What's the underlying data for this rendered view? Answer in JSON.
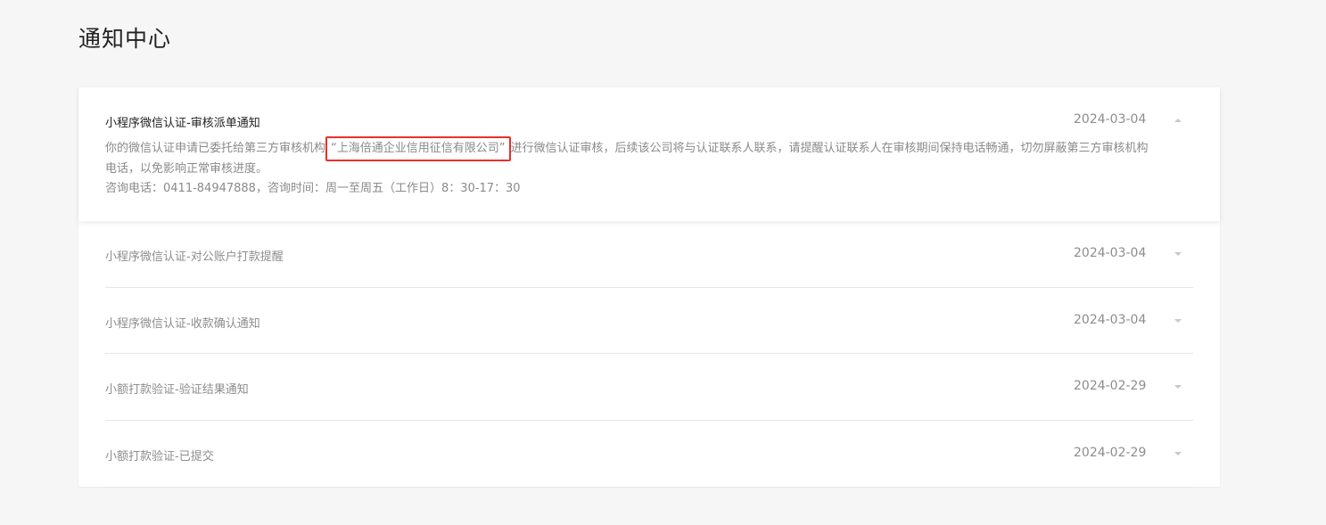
{
  "page": {
    "title": "通知中心"
  },
  "notifications": [
    {
      "title": "小程序微信认证-审核派单通知",
      "date": "2024-03-04",
      "expanded": true,
      "body_before": "你的微信认证申请已委托给第三方审核机构",
      "body_highlight": "“上海倍通企业信用征信有限公司”",
      "body_after": "进行微信认证审核，后续该公司将与认证联系人联系，请提醒认证联系人在审核期间保持电话畅通，切勿屏蔽第三方审核机构电话，以免影响正常审核进度。",
      "body_contact": "咨询电话：0411-84947888，咨询时间：周一至周五（工作日）8：30-17：30"
    },
    {
      "title": "小程序微信认证-对公账户打款提醒",
      "date": "2024-03-04",
      "expanded": false
    },
    {
      "title": "小程序微信认证-收款确认通知",
      "date": "2024-03-04",
      "expanded": false
    },
    {
      "title": "小额打款验证-验证结果通知",
      "date": "2024-02-29",
      "expanded": false
    },
    {
      "title": "小额打款验证-已提交",
      "date": "2024-02-29",
      "expanded": false
    }
  ],
  "icons": {
    "expanded_arrow": "chevron-up-icon",
    "collapsed_arrow": "chevron-down-icon"
  },
  "colors": {
    "highlight_border": "#e8302a",
    "background": "#f6f6f7",
    "panel": "#ffffff"
  }
}
